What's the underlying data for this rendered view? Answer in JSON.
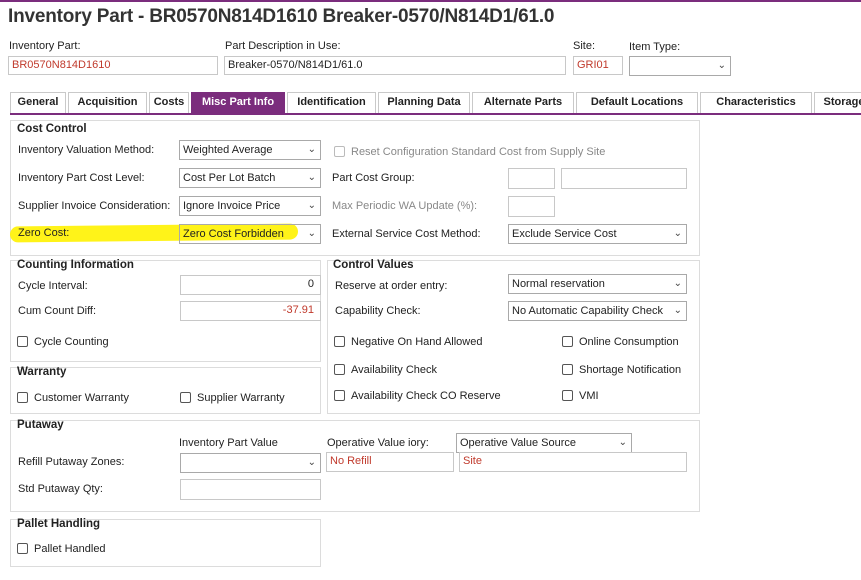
{
  "page": {
    "title": "Inventory Part - BR0570N814D1610 Breaker-0570/N814D1/61.0"
  },
  "header": {
    "inventory_part_label": "Inventory Part:",
    "inventory_part_value": "BR0570N814D1610",
    "description_label": "Part Description in Use:",
    "description_value": "Breaker-0570/N814D1/61.0",
    "site_label": "Site:",
    "site_value": "GRI01",
    "item_type_label": "Item Type:",
    "item_type_value": ""
  },
  "tabs": [
    {
      "label": "General"
    },
    {
      "label": "Acquisition"
    },
    {
      "label": "Costs"
    },
    {
      "label": "Misc Part Info"
    },
    {
      "label": "Identification"
    },
    {
      "label": "Planning Data"
    },
    {
      "label": "Alternate Parts"
    },
    {
      "label": "Default Locations"
    },
    {
      "label": "Characteristics"
    },
    {
      "label": "Storage"
    }
  ],
  "cost_control": {
    "title": "Cost Control",
    "valuation_label": "Inventory Valuation Method:",
    "valuation_value": "Weighted Average",
    "cost_level_label": "Inventory Part Cost Level:",
    "cost_level_value": "Cost Per Lot Batch",
    "supplier_invoice_label": "Supplier Invoice Consideration:",
    "supplier_invoice_value": "Ignore Invoice Price",
    "zero_cost_label": "Zero Cost:",
    "zero_cost_value": "Zero Cost Forbidden",
    "reset_config_label": "Reset Configuration Standard Cost from Supply Site",
    "part_cost_group_label": "Part Cost Group:",
    "max_periodic_label": "Max Periodic WA Update (%):",
    "external_service_label": "External Service Cost Method:",
    "external_service_value": "Exclude Service Cost"
  },
  "counting": {
    "title": "Counting Information",
    "cycle_interval_label": "Cycle Interval:",
    "cycle_interval_value": "0",
    "cum_count_label": "Cum Count Diff:",
    "cum_count_value": "-37.91",
    "cycle_counting_label": "Cycle Counting"
  },
  "control_values": {
    "title": "Control Values",
    "reserve_label": "Reserve at order entry:",
    "reserve_value": "Normal reservation",
    "capability_label": "Capability Check:",
    "capability_value": "No Automatic Capability Check",
    "negative_onhand_label": "Negative On Hand Allowed",
    "online_consumption_label": "Online Consumption",
    "availability_check_label": "Availability Check",
    "shortage_notification_label": "Shortage Notification",
    "availability_co_label": "Availability Check CO Reserve",
    "vmi_label": "VMI"
  },
  "warranty": {
    "title": "Warranty",
    "customer_label": "Customer Warranty",
    "supplier_label": "Supplier Warranty"
  },
  "putaway": {
    "title": "Putaway",
    "inv_part_value_label": "Inventory Part Value",
    "operative_value_label": "Operative Value",
    "operative_value_suffix": "iory:",
    "operative_source_value": "Operative Value Source",
    "refill_label": "Refill Putaway Zones:",
    "refill_operative_value": "No Refill",
    "refill_source_value": "Site",
    "std_qty_label": "Std Putaway Qty:"
  },
  "pallet": {
    "title": "Pallet Handling",
    "pallet_handled_label": "Pallet Handled"
  },
  "colors": {
    "accent": "#7b2d7d",
    "highlight": "#fff200",
    "value_red": "#c0392b"
  }
}
